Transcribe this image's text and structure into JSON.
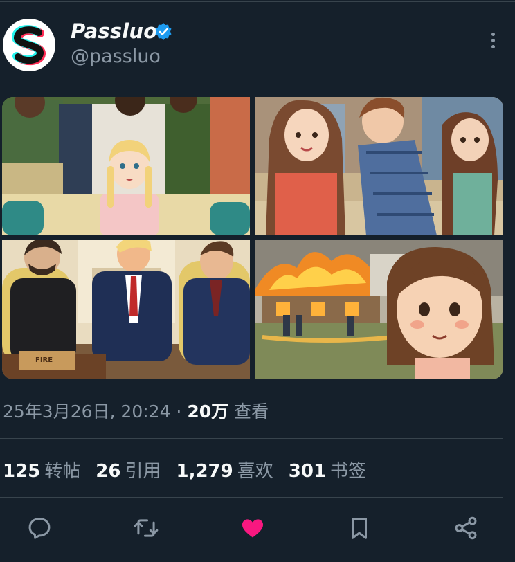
{
  "author": {
    "display_name": "Passluo",
    "handle": "@passluo",
    "verified": true,
    "avatar_icon": "stylized-s-logo"
  },
  "media": {
    "images": [
      {
        "label": "anime-style crowd with girl on sofa"
      },
      {
        "label": "anime-style three teens on street"
      },
      {
        "label": "anime-style meeting in oval office"
      },
      {
        "label": "anime-style girl in front of burning house"
      }
    ],
    "box_text": "FIRE"
  },
  "meta": {
    "timestamp": "25年3月26日, 20:24",
    "separator": "·",
    "views_count": "20万",
    "views_label": "查看"
  },
  "stats": [
    {
      "count": "125",
      "label": "转帖"
    },
    {
      "count": "26",
      "label": "引用"
    },
    {
      "count": "1,279",
      "label": "喜欢"
    },
    {
      "count": "301",
      "label": "书签"
    }
  ],
  "actions": {
    "reply_icon": "reply-icon",
    "retweet_icon": "retweet-icon",
    "like_icon": "heart-icon",
    "bookmark_icon": "bookmark-icon",
    "share_icon": "share-icon"
  },
  "colors": {
    "background": "#15202b",
    "text": "#f7f9f9",
    "secondary": "#8b98a5",
    "verified": "#1d9bf0",
    "like": "#f91880",
    "divider": "#38444d"
  }
}
